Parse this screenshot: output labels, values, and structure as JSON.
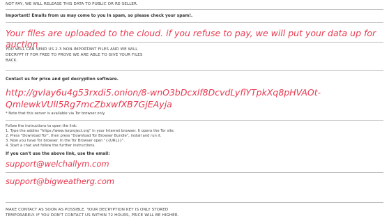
{
  "note": {
    "top_warning": "NOT PAY, WE WILL RELEASE THIS DATA TO PUBLIC OR RE-SELLER.",
    "important": "Important! Emails from us may come to you in spam, so please check your spam!.",
    "cloud_warning": "Your files are uploaded to the cloud. if you refuse to pay, we will put your data up for auction",
    "sample_offer_line1": "YOU WILL CAN SEND US 2-3 NON-IMPORTANT FILES AND WE WILL",
    "sample_offer_line2": "DECRYPT IT FOR FREE TO PROVE WE ARE ABLE TO GIVE YOUR FILES",
    "sample_offer_line3": "BACK.",
    "contact_heading": "Contact us for price and get decryption software.",
    "onion_url_line1": "http://gvlay6u4g53rxdi5.onion/8-wnO3bDcxlf8DcvdLyflYTpkXq8pHVAOt-",
    "onion_url_line2": "QmlewkVUlI5Rg7mcZbxwfXB7GjEAyja",
    "tor_note": "* Note that this server is available via Tor browser only",
    "instructions": {
      "intro": "Follow the instructions to open the link:",
      "step1": "1. Type the addres \"https://www.torproject.org\" in your Internet browser. It opens the Tor site.",
      "step2": "2. Press \"Download Tor\", then press \"Download Tor Browser Bundle\", install and run it.",
      "step3": "3. Now you have Tor browser. In the Tor Browser open \"{{URL}}\".",
      "step4": "4. Start a chat and follow the further instructions."
    },
    "email_heading": "If you can't use the above link, use the email:",
    "email1": "support@welchallym.com",
    "email2": "support@bigweatherg.com",
    "footer_line1": "MAKE CONTACT AS SOON AS POSSIBLE. YOUR DECRYPTION KEY IS ONLY STORED",
    "footer_line2": "TEMPORARELY. IF YOU DON'T CONTACT US WITHIN 72 HOURS, PRICE WILL BE HIGHER."
  },
  "colors": {
    "accent_red": "#e8384f",
    "text": "#3a3a3a",
    "rule": "#bdbdbd"
  }
}
